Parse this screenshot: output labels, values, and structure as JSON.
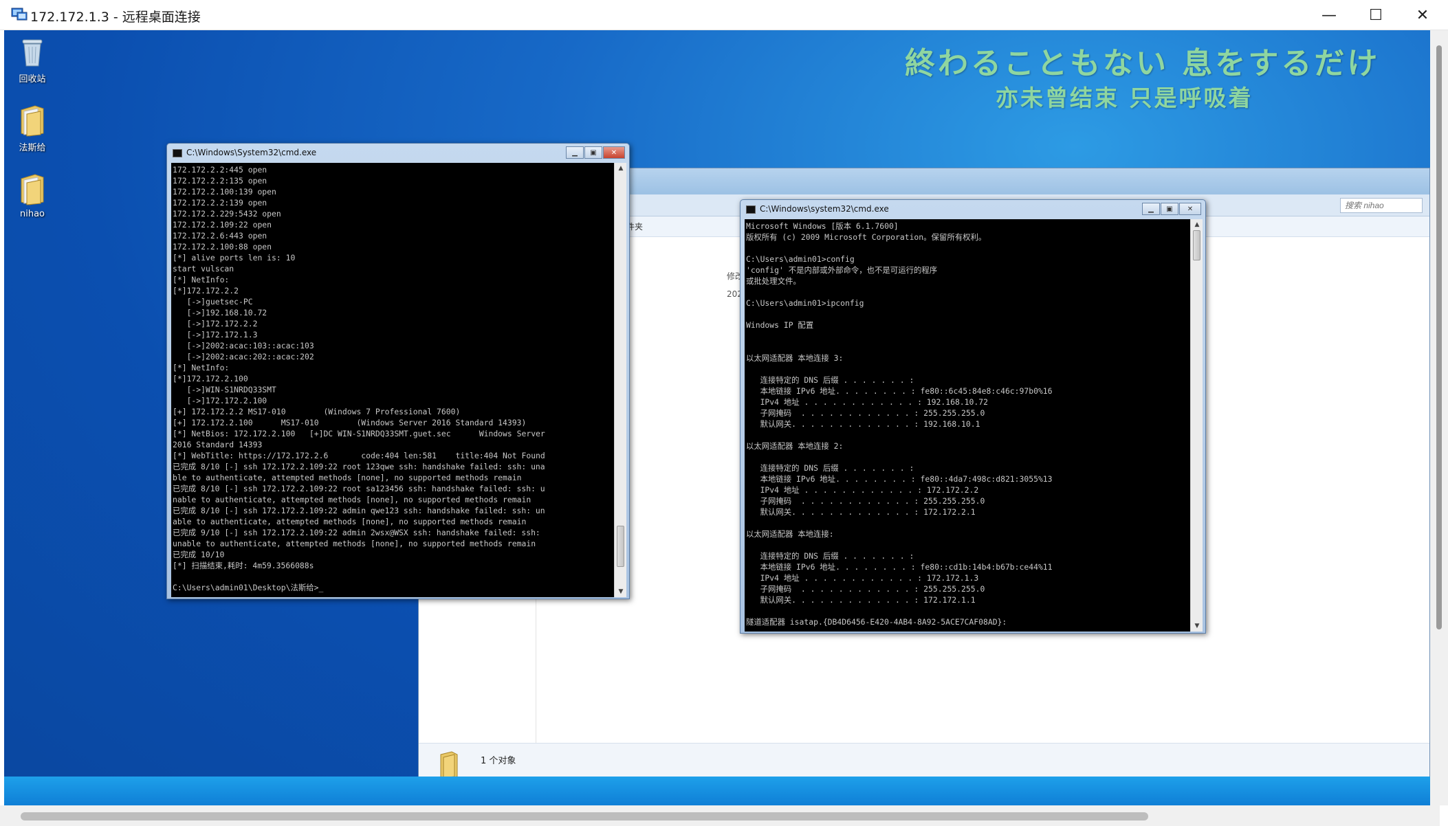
{
  "rdp": {
    "title": "172.172.1.3 - 远程桌面连接",
    "min_label": "—",
    "max_label": "☐",
    "close_label": "✕"
  },
  "desktop": {
    "icons": [
      {
        "label": "回收站",
        "icon": "recycle-bin-icon"
      },
      {
        "label": "法斯给",
        "icon": "folder-icon"
      },
      {
        "label": "nihao",
        "icon": "folder-icon"
      }
    ],
    "lyric_jp": "終わることもない 息をするだけ",
    "lyric_cn": "亦未曾结束 只是呼吸着"
  },
  "explorer": {
    "search_placeholder": "搜索 nihao",
    "folder_label": "件夹",
    "col_modified": "修改",
    "col_date": "202",
    "status_text": "1 个对象"
  },
  "cmd1": {
    "title": "C:\\Windows\\System32\\cmd.exe",
    "output": "172.172.2.2:445 open\n172.172.2.2:135 open\n172.172.2.100:139 open\n172.172.2.2:139 open\n172.172.2.229:5432 open\n172.172.2.109:22 open\n172.172.2.6:443 open\n172.172.2.100:88 open\n[*] alive ports len is: 10\nstart vulscan\n[*] NetInfo:\n[*]172.172.2.2\n   [->]guetsec-PC\n   [->]192.168.10.72\n   [->]172.172.2.2\n   [->]172.172.1.3\n   [->]2002:acac:103::acac:103\n   [->]2002:acac:202::acac:202\n[*] NetInfo:\n[*]172.172.2.100\n   [->]WIN-S1NRDQ33SMT\n   [->]172.172.2.100\n[+] 172.172.2.2 MS17-010        (Windows 7 Professional 7600)\n[+] 172.172.2.100      MS17-010        (Windows Server 2016 Standard 14393)\n[*] NetBios: 172.172.2.100   [+]DC WIN-S1NRDQ33SMT.guet.sec      Windows Server\n2016 Standard 14393\n[*] WebTitle: https://172.172.2.6       code:404 len:581    title:404 Not Found\n已完成 8/10 [-] ssh 172.172.2.109:22 root 123qwe ssh: handshake failed: ssh: una\nble to authenticate, attempted methods [none], no supported methods remain\n已完成 8/10 [-] ssh 172.172.2.109:22 root sa123456 ssh: handshake failed: ssh: u\nnable to authenticate, attempted methods [none], no supported methods remain\n已完成 8/10 [-] ssh 172.172.2.109:22 admin qwe123 ssh: handshake failed: ssh: un\nable to authenticate, attempted methods [none], no supported methods remain\n已完成 9/10 [-] ssh 172.172.2.109:22 admin 2wsx@WSX ssh: handshake failed: ssh:\nunable to authenticate, attempted methods [none], no supported methods remain\n已完成 10/10\n[*] 扫描结束,耗时: 4m59.3566088s\n\nC:\\Users\\admin01\\Desktop\\法斯给>_"
  },
  "cmd2": {
    "title": "C:\\Windows\\system32\\cmd.exe",
    "output": "Microsoft Windows [版本 6.1.7600]\n版权所有 (c) 2009 Microsoft Corporation。保留所有权利。\n\nC:\\Users\\admin01>config\n'config' 不是内部或外部命令，也不是可运行的程序\n或批处理文件。\n\nC:\\Users\\admin01>ipconfig\n\nWindows IP 配置\n\n\n以太网适配器 本地连接 3:\n\n   连接特定的 DNS 后缀 . . . . . . . :\n   本地链接 IPv6 地址. . . . . . . . : fe80::6c45:84e8:c46c:97b0%16\n   IPv4 地址 . . . . . . . . . . . . : 192.168.10.72\n   子网掩码  . . . . . . . . . . . . : 255.255.255.0\n   默认网关. . . . . . . . . . . . . : 192.168.10.1\n\n以太网适配器 本地连接 2:\n\n   连接特定的 DNS 后缀 . . . . . . . :\n   本地链接 IPv6 地址. . . . . . . . : fe80::4da7:498c:d821:3055%13\n   IPv4 地址 . . . . . . . . . . . . : 172.172.2.2\n   子网掩码  . . . . . . . . . . . . : 255.255.255.0\n   默认网关. . . . . . . . . . . . . : 172.172.2.1\n\n以太网适配器 本地连接:\n\n   连接特定的 DNS 后缀 . . . . . . . :\n   本地链接 IPv6 地址. . . . . . . . : fe80::cd1b:14b4:b67b:ce44%11\n   IPv4 地址 . . . . . . . . . . . . : 172.172.1.3\n   子网掩码  . . . . . . . . . . . . : 255.255.255.0\n   默认网关. . . . . . . . . . . . . : 172.172.1.1\n\n隧道适配器 isatap.{DB4D6456-E420-4AB4-8A92-5ACE7CAF08AD}:"
  }
}
